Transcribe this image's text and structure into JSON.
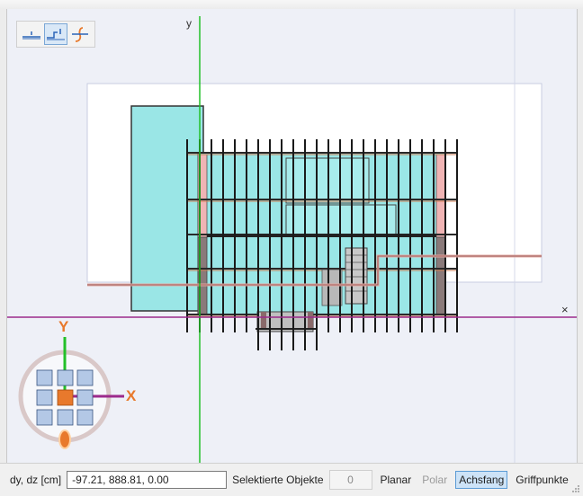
{
  "viewport": {
    "axis_y_label": "y",
    "axis_close_label": "×",
    "compass": {
      "y_label": "Y",
      "x_label": "X"
    },
    "colors": {
      "y_axis": "#22c028",
      "x_axis": "#9c2a8c",
      "glass": "#9ae6e6",
      "compass_accent": "#e8792c",
      "compass_tile": "#b3c8e6"
    }
  },
  "view_tools": {
    "icons": [
      "ground-level-icon",
      "storey-step-icon",
      "section-curve-icon"
    ],
    "active_index": 1
  },
  "statusbar": {
    "coord_label": "dy, dz [cm]",
    "coord_value": "-97.21, 888.81, 0.00",
    "selected_label": "Selektierte Objekte",
    "selected_count": "0",
    "planar": "Planar",
    "polar": "Polar",
    "axis_snap": "Achsfang",
    "grip_points": "Griffpunkte"
  }
}
